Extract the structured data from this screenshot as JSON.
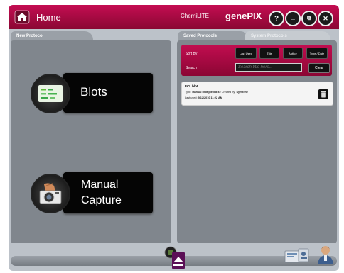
{
  "titlebar": {
    "home_label": "Home",
    "brand_small": "ChemiLITE",
    "brand_big": "genePIX",
    "help_glyph": "?",
    "minimize_glyph": "_",
    "restore_glyph": "⧉",
    "close_glyph": "✕"
  },
  "tabs": {
    "new_protocol": "New Protocol",
    "saved_protocols": "Saved Protocols",
    "system_protocols": "System Protocols"
  },
  "left_panel": {
    "blots_label": "Blots",
    "manual_line1": "Manual",
    "manual_line2": "Capture"
  },
  "right_panel": {
    "sort_by_label": "Sort By",
    "search_label": "Search",
    "sort_buttons": [
      "Last Used",
      "Title",
      "Author",
      "Type / Date"
    ],
    "search_placeholder": "Search title here...",
    "clear_label": "Clear",
    "card": {
      "title": "ECL blot",
      "type_label": "Type:",
      "type_value": "Manual Multiplexed x2",
      "created_label": "Created by:",
      "created_value": "SynGene",
      "last_used_label": "Last used:",
      "last_used_value": "9/12/2010 11:22 AM"
    }
  },
  "icons": {
    "home": "home-icon",
    "blots": "blot-membrane-icon",
    "manual": "camera-hand-icon",
    "trash": "trash-icon",
    "eject": "eject-icon",
    "tools": "tools-icon",
    "admin": "admin-user-icon"
  },
  "colors": {
    "accent": "#b00b48",
    "panel": "#80868d",
    "background": "#bcc2c9"
  }
}
